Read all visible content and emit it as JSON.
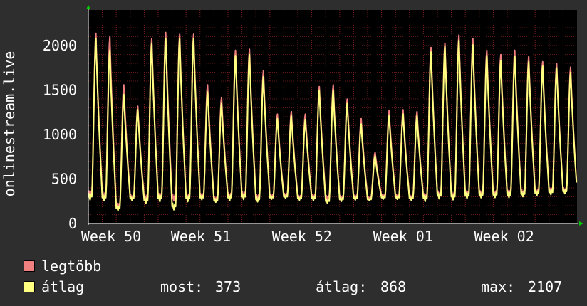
{
  "chart_data": {
    "type": "line",
    "ylabel": "onlinestream.live",
    "ylim": [
      0,
      2400
    ],
    "yticks": [
      0,
      500,
      1000,
      1500,
      2000
    ],
    "xlabels": [
      "Week 50",
      "Week 51",
      "Week 52",
      "Week 01",
      "Week 02"
    ],
    "grid": true,
    "colors": {
      "background": "#2e2e2e",
      "plot_bg": "#000000",
      "grid": "#7a1f1f",
      "axis": "#ffffff",
      "arrow": "#00cc00"
    },
    "days": 35,
    "series": [
      {
        "name": "legtöbb",
        "color": "#f08080",
        "daily_peak": [
          2140,
          2100,
          1560,
          1320,
          2080,
          2150,
          2130,
          2130,
          1560,
          1420,
          1950,
          1960,
          1720,
          1230,
          1260,
          1230,
          1540,
          1560,
          1400,
          1180,
          800,
          1270,
          1280,
          1260,
          1980,
          2030,
          2120,
          2080,
          1950,
          1900,
          1950,
          1880,
          1820,
          1800,
          1760
        ],
        "daily_min": [
          330,
          320,
          200,
          300,
          290,
          300,
          290,
          300,
          310,
          280,
          310,
          320,
          300,
          310,
          320,
          300,
          300,
          290,
          290,
          300,
          290,
          310,
          310,
          300,
          300,
          330,
          320,
          330,
          340,
          340,
          340,
          350,
          360,
          370,
          373
        ]
      },
      {
        "name": "átlag",
        "color": "#ffff80",
        "daily_peak": [
          2080,
          1950,
          1450,
          1280,
          2020,
          2080,
          2080,
          2080,
          1480,
          1350,
          1890,
          1900,
          1650,
          1180,
          1210,
          1170,
          1500,
          1500,
          1350,
          1120,
          760,
          1210,
          1230,
          1210,
          1930,
          1990,
          2060,
          2010,
          1890,
          1830,
          1880,
          1820,
          1770,
          1750,
          1700
        ],
        "daily_min": [
          300,
          290,
          170,
          280,
          260,
          280,
          190,
          280,
          290,
          260,
          290,
          300,
          270,
          290,
          300,
          280,
          280,
          250,
          270,
          280,
          270,
          290,
          290,
          280,
          280,
          310,
          300,
          310,
          320,
          320,
          320,
          330,
          340,
          350,
          360
        ]
      }
    ],
    "legend": [
      {
        "label": "legtöbb",
        "color": "#f08080"
      },
      {
        "label": "átlag",
        "color": "#ffff80"
      }
    ],
    "stats": {
      "most_label": "most:",
      "most": "373",
      "atlag_label": "átlag:",
      "atlag": "868",
      "max_label": "max:",
      "max": "2107"
    }
  }
}
